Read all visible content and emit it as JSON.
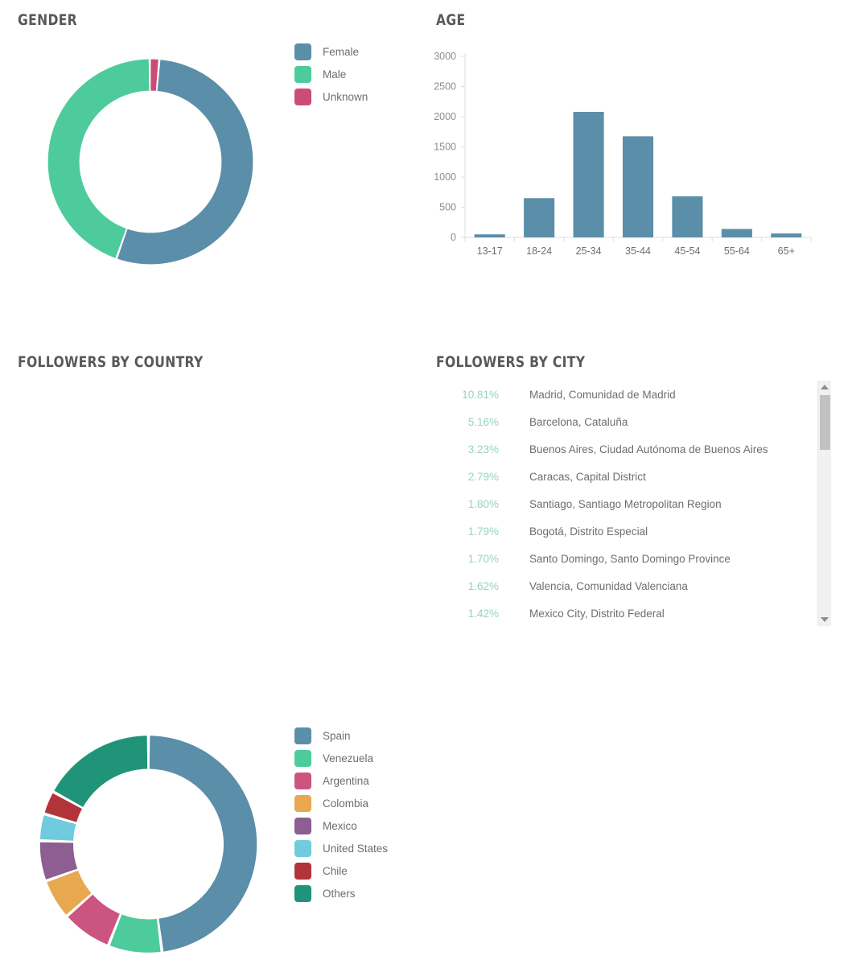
{
  "panels": {
    "gender": {
      "title": "GENDER"
    },
    "age": {
      "title": "AGE"
    },
    "country": {
      "title": "FOLLOWERS BY COUNTRY"
    },
    "city": {
      "title": "FOLLOWERS BY CITY"
    }
  },
  "chart_data": [
    {
      "id": "gender",
      "type": "pie",
      "title": "GENDER",
      "variant": "donut",
      "legend_position": "right",
      "labels": [
        "Female",
        "Male",
        "Unknown"
      ],
      "values": [
        54.0,
        44.5,
        1.5
      ],
      "colors": [
        "#5b8ea8",
        "#4ecb9c",
        "#cb4d75"
      ]
    },
    {
      "id": "age",
      "type": "bar",
      "title": "AGE",
      "categories": [
        "13-17",
        "18-24",
        "25-34",
        "35-44",
        "45-54",
        "55-64",
        "65+"
      ],
      "values": [
        50,
        650,
        2080,
        1675,
        680,
        140,
        65
      ],
      "xlabel": "",
      "ylabel": "",
      "ylim": [
        0,
        3000
      ],
      "yticks": [
        0,
        500,
        1000,
        1500,
        2000,
        2500,
        3000
      ],
      "ytick_labels": [
        "0",
        "500",
        "1000",
        "1500",
        "2000",
        "2500",
        "3000"
      ],
      "grid": false,
      "bar_color": "#5b8ea8"
    },
    {
      "id": "country",
      "type": "pie",
      "title": "FOLLOWERS BY COUNTRY",
      "variant": "donut",
      "legend_position": "right",
      "labels": [
        "Spain",
        "Venezuela",
        "Argentina",
        "Colombia",
        "Mexico",
        "United States",
        "Chile",
        "Others"
      ],
      "values": [
        48.0,
        8.0,
        7.5,
        6.0,
        6.0,
        4.0,
        3.5,
        17.0
      ],
      "colors": [
        "#5b8ea8",
        "#4ecb9c",
        "#cb5580",
        "#e8a84f",
        "#8c5e91",
        "#6fcbdd",
        "#b2343b",
        "#1f9478"
      ]
    },
    {
      "id": "city",
      "type": "table",
      "title": "FOLLOWERS BY CITY",
      "columns": [
        "percent",
        "city"
      ],
      "rows": [
        {
          "percent": "10.81%",
          "city": "Madrid, Comunidad de Madrid"
        },
        {
          "percent": "5.16%",
          "city": "Barcelona, Cataluña"
        },
        {
          "percent": "3.23%",
          "city": "Buenos Aires, Ciudad Autónoma de Buenos Aires"
        },
        {
          "percent": "2.79%",
          "city": "Caracas, Capital District"
        },
        {
          "percent": "1.80%",
          "city": "Santiago, Santiago Metropolitan Region"
        },
        {
          "percent": "1.79%",
          "city": "Bogotá, Distrito Especial"
        },
        {
          "percent": "1.70%",
          "city": "Santo Domingo, Santo Domingo Province"
        },
        {
          "percent": "1.62%",
          "city": "Valencia, Comunidad Valenciana"
        },
        {
          "percent": "1.42%",
          "city": "Mexico City, Distrito Federal"
        }
      ]
    }
  ],
  "scrollbar": {
    "up_arrow": "scroll-up-arrow",
    "down_arrow": "scroll-down-arrow",
    "thumb_position_percent": 6
  }
}
